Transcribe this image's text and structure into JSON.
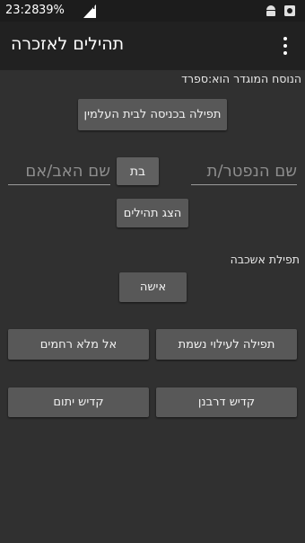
{
  "status_bar": {
    "time": "23:28",
    "battery": "39%",
    "icons": [
      "signal-icon",
      "android-icon",
      "screenshot-icon"
    ]
  },
  "app_bar": {
    "title": "תהילים לאזכרה",
    "menu_icon": "more-vert-icon"
  },
  "main": {
    "nusach_label": "הנוסח המוגדר הוא:ספרד",
    "entry_prayer_button": "תפילה בכניסה לבית העלמין",
    "deceased_name_placeholder": "שם הנפטר/ת",
    "gender_button": "בת",
    "parent_name_placeholder": "שם האב/אם",
    "show_tehilim_button": "הצג תהילים",
    "ashkava_label": "תפילת אשכבה",
    "woman_button": "אישה",
    "neshama_button": "תפילה לעילוי נשמת",
    "el_male_button": "אל מלא רחמים",
    "kaddish_derabanan_button": "קדיש דרבנן",
    "kaddish_yatom_button": "קדיש יתום"
  },
  "colors": {
    "background": "#303030",
    "app_bar": "#212121",
    "status_bar": "#1c1c1c",
    "button": "#585858"
  }
}
